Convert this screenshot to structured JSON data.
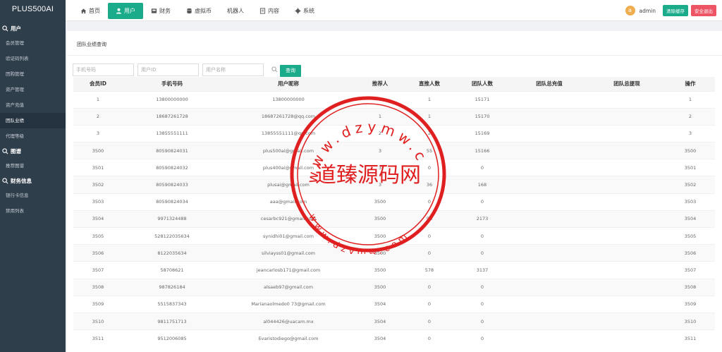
{
  "app": {
    "logo": "PLUS500AI"
  },
  "sidebar": {
    "sections": [
      {
        "title": "用户",
        "items": [
          "会员管理",
          "验证码列表",
          "团购管理",
          "资产管理",
          "资产充值",
          "团队业绩",
          "代理等级"
        ]
      },
      {
        "title": "图谱",
        "items": [
          "推荐图谱"
        ]
      },
      {
        "title": "财务信息",
        "items": [
          "银行卡信息",
          "禁用列表"
        ]
      }
    ],
    "active_item": "团队业绩"
  },
  "nav": {
    "items": [
      "首页",
      "用户",
      "财务",
      "虚拟币",
      "机器人",
      "内容",
      "系统"
    ],
    "active": "用户"
  },
  "user": {
    "avatar_letter": "a",
    "name": "admin"
  },
  "buttons": {
    "clear_cache": "清除缓存",
    "logout": "安全退出",
    "query": "查询"
  },
  "page": {
    "title": "团队业绩查询"
  },
  "filters": {
    "phone_placeholder": "手机号码",
    "userid_placeholder": "用户ID",
    "username_placeholder": "用户名称"
  },
  "table": {
    "headers": [
      "会员ID",
      "手机号码",
      "用户昵称",
      "推荐人",
      "直推人数",
      "团队人数",
      "团队总充值",
      "团队总提现",
      "操作"
    ],
    "rows": [
      [
        "1",
        "13800000000",
        "13800000000",
        "0",
        "1",
        "15171",
        "",
        "",
        "1"
      ],
      [
        "2",
        "18687261728",
        "18687261728@qq.com",
        "1",
        "1",
        "15170",
        "",
        "",
        "2"
      ],
      [
        "3",
        "13855551111",
        "13855551111@qq.com",
        "2",
        "2",
        "15169",
        "",
        "",
        "3"
      ],
      [
        "3500",
        "80590824031",
        "plus500ai@gmail.com",
        "3",
        "55",
        "15166",
        "",
        "",
        "3500"
      ],
      [
        "3501",
        "80590824032",
        "plus400ai@gmail.com",
        "3",
        "0",
        "0",
        "",
        "",
        "3501"
      ],
      [
        "3502",
        "80590824033",
        "plusai@gmail.com",
        "3",
        "36",
        "168",
        "",
        "",
        "3502"
      ],
      [
        "3503",
        "80590824034",
        "aaa@gmail.com",
        "3500",
        "0",
        "0",
        "",
        "",
        "3503"
      ],
      [
        "3504",
        "9971324488",
        "cesarbc921@gmail.com",
        "3500",
        "98",
        "2173",
        "",
        "",
        "3504"
      ],
      [
        "3505",
        "528122035634",
        "synidhi01@gmail.com",
        "3500",
        "0",
        "0",
        "",
        "",
        "3505"
      ],
      [
        "3506",
        "8122035634",
        "silviayss01@gmail.com",
        "3500",
        "0",
        "0",
        "",
        "",
        "3506"
      ],
      [
        "3507",
        "58708621",
        "jeancarlosb171@gmail.com",
        "3500",
        "578",
        "3137",
        "",
        "",
        "3507"
      ],
      [
        "3508",
        "987826184",
        "alsaeb97@gmail.com",
        "3500",
        "0",
        "0",
        "",
        "",
        "3508"
      ],
      [
        "3509",
        "5515837343",
        "Marianaolmedo0 73@gmail.com",
        "3504",
        "0",
        "0",
        "",
        "",
        "3509"
      ],
      [
        "3510",
        "9811751713",
        "al044426@uacam.mx",
        "3504",
        "0",
        "0",
        "",
        "",
        "3510"
      ],
      [
        "3511",
        "9512006085",
        "Evaristodiego@gmail.com",
        "3504",
        "0",
        "0",
        "",
        "",
        "3511"
      ]
    ]
  },
  "watermark": {
    "text": "道臻源码网",
    "top_text": "www.dzymw.com",
    "bottom_text": "www.dzymw.com",
    "color": "#e02020"
  }
}
